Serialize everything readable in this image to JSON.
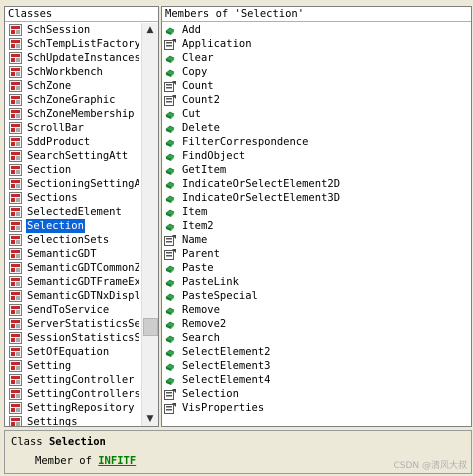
{
  "classes": {
    "header": "Classes",
    "items": [
      "SchSession",
      "SchTempListFactory",
      "SchUpdateInstances",
      "SchWorkbench",
      "SchZone",
      "SchZoneGraphic",
      "SchZoneMembership",
      "ScrollBar",
      "SddProduct",
      "SearchSettingAtt",
      "Section",
      "SectioningSettingAt",
      "Sections",
      "SelectedElement",
      "Selection",
      "SelectionSets",
      "SemanticGDT",
      "SemanticGDTCommonZo",
      "SemanticGDTFrameExt",
      "SemanticGDTNxDispla",
      "SendToService",
      "ServerStatisticsSet",
      "SessionStatisticsSe",
      "SetOfEquation",
      "Setting",
      "SettingController",
      "SettingControllers",
      "SettingRepository",
      "Settings"
    ],
    "selected_index": 14
  },
  "members": {
    "header": "Members of 'Selection'",
    "items": [
      {
        "name": "Add",
        "icon": "method-icon"
      },
      {
        "name": "Application",
        "icon": "property-icon"
      },
      {
        "name": "Clear",
        "icon": "method-icon"
      },
      {
        "name": "Copy",
        "icon": "method-icon"
      },
      {
        "name": "Count",
        "icon": "property-icon"
      },
      {
        "name": "Count2",
        "icon": "property-icon"
      },
      {
        "name": "Cut",
        "icon": "method-icon"
      },
      {
        "name": "Delete",
        "icon": "method-icon"
      },
      {
        "name": "FilterCorrespondence",
        "icon": "method-icon"
      },
      {
        "name": "FindObject",
        "icon": "method-icon"
      },
      {
        "name": "GetItem",
        "icon": "method-icon"
      },
      {
        "name": "IndicateOrSelectElement2D",
        "icon": "method-icon"
      },
      {
        "name": "IndicateOrSelectElement3D",
        "icon": "method-icon"
      },
      {
        "name": "Item",
        "icon": "method-icon"
      },
      {
        "name": "Item2",
        "icon": "method-icon"
      },
      {
        "name": "Name",
        "icon": "property-icon"
      },
      {
        "name": "Parent",
        "icon": "property-icon"
      },
      {
        "name": "Paste",
        "icon": "method-icon"
      },
      {
        "name": "PasteLink",
        "icon": "method-icon"
      },
      {
        "name": "PasteSpecial",
        "icon": "method-icon"
      },
      {
        "name": "Remove",
        "icon": "method-icon"
      },
      {
        "name": "Remove2",
        "icon": "method-icon"
      },
      {
        "name": "Search",
        "icon": "method-icon"
      },
      {
        "name": "SelectElement2",
        "icon": "method-icon"
      },
      {
        "name": "SelectElement3",
        "icon": "method-icon"
      },
      {
        "name": "SelectElement4",
        "icon": "method-icon"
      },
      {
        "name": "Selection",
        "icon": "property-icon"
      },
      {
        "name": "VisProperties",
        "icon": "property-icon"
      }
    ]
  },
  "detail": {
    "class_prefix": "Class",
    "class_name": "Selection",
    "member_of_prefix": "Member of",
    "member_of_link": "INFITF"
  },
  "scroll": {
    "classes_position": 0.78
  },
  "watermark": "CSDN @清风大叔",
  "colors": {
    "selection": "#0a64d8",
    "link": "#008000",
    "class_icon_red": "#c0282d"
  }
}
